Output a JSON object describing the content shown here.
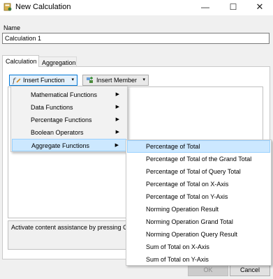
{
  "window": {
    "title": "New Calculation",
    "minimize_glyph": "—",
    "maximize_glyph": "☐",
    "close_glyph": "✕"
  },
  "name_section": {
    "label": "Name",
    "value": "Calculation 1"
  },
  "tabs": [
    {
      "label": "Calculation",
      "active": true
    },
    {
      "label": "Aggregation",
      "active": false
    }
  ],
  "toolbar": {
    "insert_function_label": "Insert Function",
    "insert_member_label": "Insert Member",
    "dropdown_glyph": "▾"
  },
  "function_menu": {
    "submenu_arrow": "▶",
    "items": [
      {
        "label": "Mathematical Functions"
      },
      {
        "label": "Data Functions"
      },
      {
        "label": "Percentage Functions"
      },
      {
        "label": "Boolean Operators"
      },
      {
        "label": "Aggregate Functions",
        "highlighted": true
      }
    ]
  },
  "aggregate_submenu": {
    "items": [
      {
        "label": "Percentage of Total",
        "highlighted": true
      },
      {
        "label": "Percentage of Total of the Grand Total"
      },
      {
        "label": "Percentage of Total of Query Total"
      },
      {
        "label": "Percentage of Total on X-Axis"
      },
      {
        "label": "Percentage of Total on Y-Axis"
      },
      {
        "label": "Norming Operation Result"
      },
      {
        "label": "Norming Operation Grand Total"
      },
      {
        "label": "Norming Operation Query Result"
      },
      {
        "label": "Sum of Total on X-Axis"
      },
      {
        "label": "Sum of Total on Y-Axis"
      }
    ]
  },
  "hint_text": "Activate content assistance by pressing CTRL+Space",
  "footer": {
    "ok_label": "OK",
    "cancel_label": "Cancel"
  },
  "colors": {
    "highlight_bg": "#cce8ff",
    "highlight_border": "#99d1ff",
    "accent": "#0078d7"
  },
  "icons": {
    "app": "calculator-icon",
    "insert_function": "function-icon",
    "insert_member": "member-icon"
  }
}
